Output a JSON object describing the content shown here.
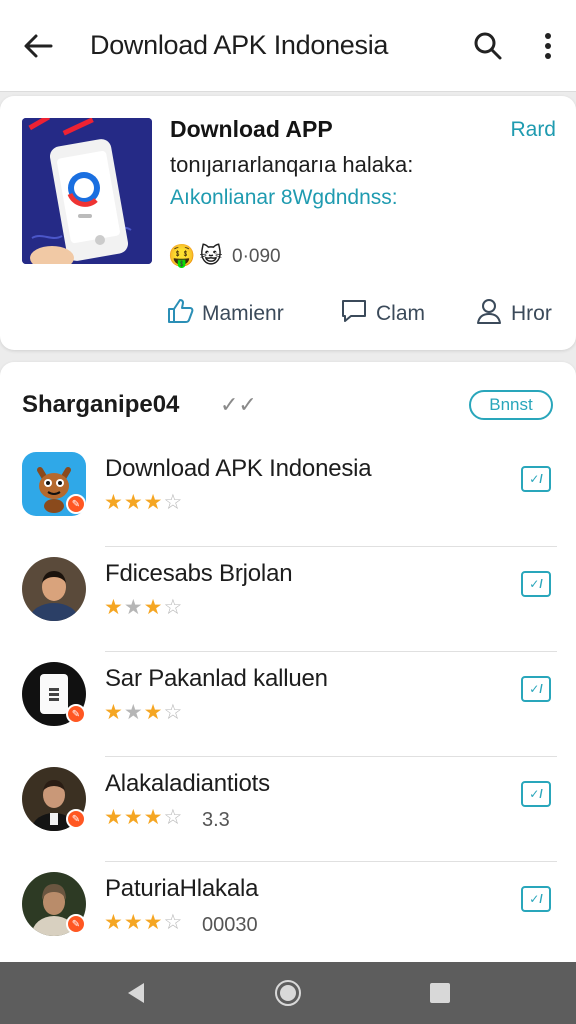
{
  "appbar": {
    "title": "Download APK Indonesia",
    "icons": [
      "arrow-back-icon",
      "search-icon",
      "more-vert-icon"
    ]
  },
  "card": {
    "title": "Download APP",
    "line1": "tonıȷarıarlanqarıa halaka:",
    "line2": "Aıkonlianar 8Wgdndnss:",
    "link": "Rard",
    "emojis": [
      "🤑",
      "😺"
    ],
    "count": "0·090",
    "actions": [
      {
        "label": "Mamienr",
        "icon": "thumbs-up-icon"
      },
      {
        "label": "Clam",
        "icon": "comment-icon"
      },
      {
        "label": "Hror",
        "icon": "user-icon"
      }
    ]
  },
  "list": {
    "title": "Sharganipe04",
    "button_label": "Bnnst",
    "items": [
      {
        "name": "Download APK Indonesia",
        "stars": 3,
        "score": "",
        "avatar": "cat-app-icon"
      },
      {
        "name": "Fdicesabs Brjolan",
        "stars": 3,
        "score": "",
        "avatar": "man-portrait"
      },
      {
        "name": "Sar Pakanlad kalluen",
        "stars": 3,
        "score": "",
        "avatar": "phone-icon"
      },
      {
        "name": "Alakaladiantiots",
        "stars": 3,
        "score": "3.3",
        "avatar": "man-portrait-2"
      },
      {
        "name": "PaturiaHlakala",
        "stars": 3,
        "score": "00030",
        "avatar": "person-portrait"
      }
    ]
  },
  "colors": {
    "accent": "#29a6bb",
    "star": "#f5a623",
    "badge": "#ff5722",
    "navbar": "#5d5d5d"
  },
  "navbar": {
    "icons": [
      "nav-back-icon",
      "nav-home-icon",
      "nav-recents-icon"
    ]
  }
}
